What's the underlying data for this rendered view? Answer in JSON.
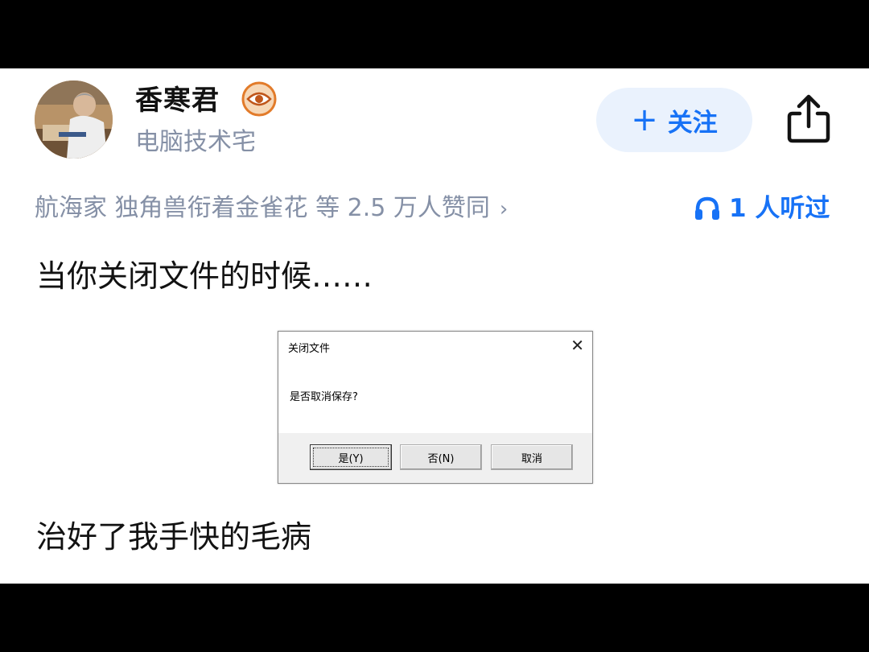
{
  "author": {
    "name": "香寒君",
    "bio": "电脑技术宅",
    "badge_icon": "eye-badge-icon"
  },
  "actions": {
    "follow_plus": "+",
    "follow_label": "关注",
    "share_icon": "share-icon"
  },
  "meta": {
    "voters_text": "航海家 独角兽衔着金雀花 等 2.5 万人赞同",
    "voters_chevron": "›",
    "listened_text": "1 人听过",
    "listened_icon": "headphones-icon"
  },
  "answer": {
    "paragraph1": "当你关闭文件的时候……",
    "paragraph2": "治好了我手快的毛病"
  },
  "dialog": {
    "title": "关闭文件",
    "close_symbol": "✕",
    "message": "是否取消保存?",
    "buttons": [
      "是(Y)",
      "否(N)",
      "取消"
    ]
  },
  "colors": {
    "accent": "#1772f6",
    "follow_bg": "#eaf2fd",
    "muted_text": "#8590a6",
    "primary_text": "#121212"
  }
}
